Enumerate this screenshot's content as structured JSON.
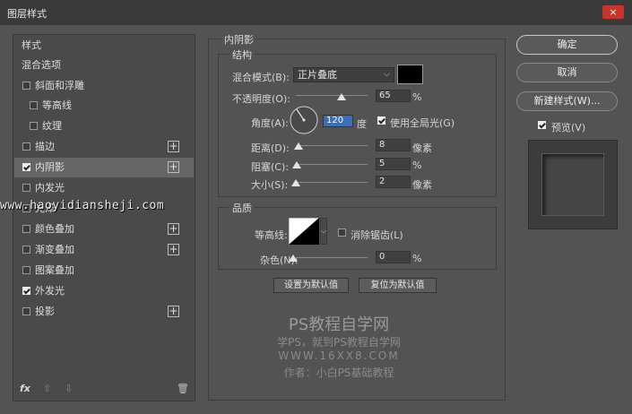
{
  "window": {
    "title": "图层样式",
    "close": "×"
  },
  "left_list": [
    {
      "label": "样式",
      "checkbox": null,
      "plus": false,
      "active": false,
      "indent": false
    },
    {
      "label": "混合选项",
      "checkbox": null,
      "plus": false,
      "active": false,
      "indent": false
    },
    {
      "label": "斜面和浮雕",
      "checkbox": false,
      "plus": false,
      "active": false,
      "indent": false
    },
    {
      "label": "等高线",
      "checkbox": false,
      "plus": false,
      "active": false,
      "indent": true
    },
    {
      "label": "纹理",
      "checkbox": false,
      "plus": false,
      "active": false,
      "indent": true
    },
    {
      "label": "描边",
      "checkbox": false,
      "plus": true,
      "active": false,
      "indent": false
    },
    {
      "label": "内阴影",
      "checkbox": true,
      "plus": true,
      "active": true,
      "indent": false
    },
    {
      "label": "内发光",
      "checkbox": false,
      "plus": false,
      "active": false,
      "indent": false
    },
    {
      "label": "光泽",
      "checkbox": false,
      "plus": false,
      "active": false,
      "indent": false
    },
    {
      "label": "颜色叠加",
      "checkbox": false,
      "plus": true,
      "active": false,
      "indent": false
    },
    {
      "label": "渐变叠加",
      "checkbox": false,
      "plus": true,
      "active": false,
      "indent": false
    },
    {
      "label": "图案叠加",
      "checkbox": false,
      "plus": false,
      "active": false,
      "indent": false
    },
    {
      "label": "外发光",
      "checkbox": true,
      "plus": false,
      "active": false,
      "indent": false
    },
    {
      "label": "投影",
      "checkbox": false,
      "plus": true,
      "active": false,
      "indent": false
    }
  ],
  "left_footer": {
    "fx": "fx",
    "up": "⇧",
    "down": "⇩",
    "trash": "🗑"
  },
  "inner_shadow": {
    "section_title": "内阴影",
    "structure_title": "结构",
    "blend_mode_label": "混合模式(B):",
    "blend_mode_value": "正片叠底",
    "color_swatch": "#000000",
    "opacity_label": "不透明度(O):",
    "opacity_value": "65",
    "opacity_unit": "%",
    "angle_label": "角度(A):",
    "angle_value": "120",
    "angle_unit": "度",
    "global_light_label": "使用全局光(G)",
    "global_light_checked": true,
    "distance_label": "距离(D):",
    "distance_value": "8",
    "distance_unit": "像素",
    "choke_label": "阻塞(C):",
    "choke_value": "5",
    "choke_unit": "%",
    "size_label": "大小(S):",
    "size_value": "2",
    "size_unit": "像素",
    "quality_title": "品质",
    "contour_label": "等高线:",
    "antialias_label": "消除锯齿(L)",
    "antialias_checked": false,
    "noise_label": "杂色(N):",
    "noise_value": "0",
    "noise_unit": "%",
    "set_default_label": "设置为默认值",
    "reset_default_label": "复位为默认值"
  },
  "right": {
    "ok_label": "确定",
    "cancel_label": "取消",
    "new_style_label": "新建样式(W)...",
    "preview_label": "预览(V)",
    "preview_checked": true
  },
  "watermark": {
    "site": "www.haoyidiansheji.com",
    "line1": "PS教程自学网",
    "line2": "学PS，就到PS教程自学网",
    "line3": "WWW.16XX8.COM",
    "line4": "作者：小白PS基础教程"
  }
}
